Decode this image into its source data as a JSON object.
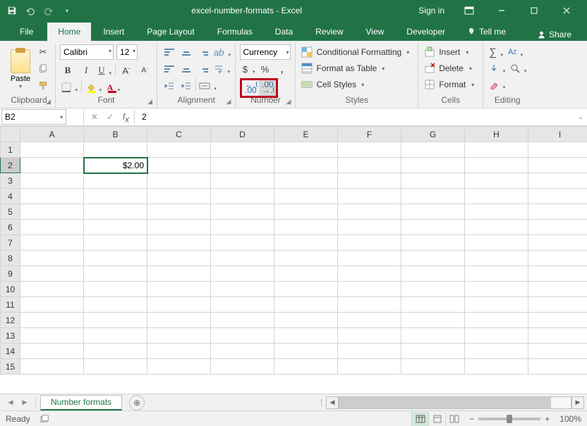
{
  "titlebar": {
    "title": "excel-number-formats - Excel",
    "signin": "Sign in"
  },
  "tabs": {
    "file": "File",
    "home": "Home",
    "insert": "Insert",
    "pagelayout": "Page Layout",
    "formulas": "Formulas",
    "data": "Data",
    "review": "Review",
    "view": "View",
    "developer": "Developer",
    "tell": "Tell me",
    "share": "Share"
  },
  "clipboard": {
    "paste": "Paste",
    "label": "Clipboard"
  },
  "font": {
    "name": "Calibri",
    "size": "12",
    "label": "Font"
  },
  "alignment": {
    "label": "Alignment"
  },
  "number": {
    "format": "Currency",
    "label": "Number",
    "dollar": "$",
    "percent": "%",
    "comma": ","
  },
  "styles": {
    "cond": "Conditional Formatting",
    "table": "Format as Table",
    "cell": "Cell Styles",
    "label": "Styles"
  },
  "cells": {
    "insert": "Insert",
    "delete": "Delete",
    "format": "Format",
    "label": "Cells"
  },
  "editing": {
    "label": "Editing"
  },
  "fbar": {
    "ref": "B2",
    "formula": "2"
  },
  "cols": [
    "A",
    "B",
    "C",
    "D",
    "E",
    "F",
    "G",
    "H",
    "I"
  ],
  "rows": [
    "1",
    "2",
    "3",
    "4",
    "5",
    "6",
    "7",
    "8",
    "9",
    "10",
    "11",
    "12",
    "13",
    "14",
    "15"
  ],
  "cell_b2": "$2.00",
  "sheet": {
    "name": "Number formats"
  },
  "status": {
    "ready": "Ready",
    "zoom": "100%"
  },
  "chart_data": null
}
